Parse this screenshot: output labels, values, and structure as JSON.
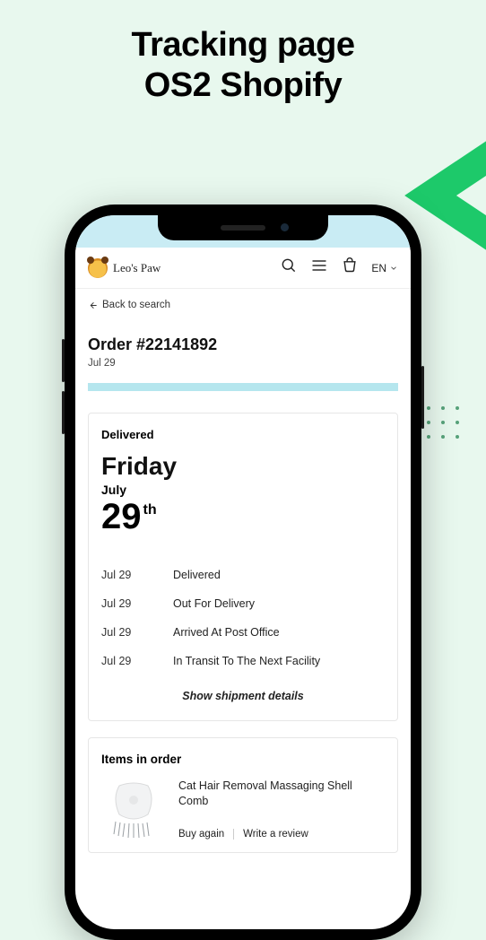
{
  "promo": {
    "line1": "Tracking page",
    "line2": "OS2 Shopify"
  },
  "store": {
    "name": "Leo's Paw",
    "language": "EN"
  },
  "nav": {
    "back_label": "Back to search"
  },
  "order": {
    "title": "Order #22141892",
    "date": "Jul 29"
  },
  "shipment": {
    "status_label": "Delivered",
    "day_name": "Friday",
    "month": "July",
    "day_num": "29",
    "ordinal": "th",
    "events": [
      {
        "date": "Jul 29",
        "status": "Delivered"
      },
      {
        "date": "Jul 29",
        "status": "Out For Delivery"
      },
      {
        "date": "Jul 29",
        "status": "Arrived At Post Office"
      },
      {
        "date": "Jul 29",
        "status": "In Transit To The Next Facility"
      }
    ],
    "show_details_label": "Show shipment details"
  },
  "items": {
    "header": "Items in order",
    "list": [
      {
        "title": "Cat Hair Removal Massaging Shell Comb",
        "buy_again_label": "Buy again",
        "review_label": "Write a review"
      }
    ]
  }
}
